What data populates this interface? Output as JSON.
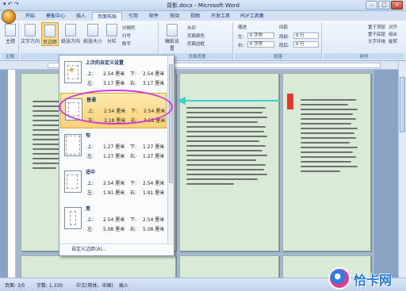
{
  "window": {
    "title": "背影.docx - Microsoft Word",
    "min": "–",
    "max": "□",
    "close": "×"
  },
  "qat": {
    "label": "▾ ↶ ↷"
  },
  "tabs": [
    {
      "label": "开始"
    },
    {
      "label": "模板中心"
    },
    {
      "label": "插入"
    },
    {
      "label": "页面布局"
    },
    {
      "label": "引用"
    },
    {
      "label": "邮件"
    },
    {
      "label": "审阅"
    },
    {
      "label": "视图"
    },
    {
      "label": "开发工具"
    },
    {
      "label": "PDF工具集"
    }
  ],
  "ribbon": {
    "themes": {
      "label": "主题",
      "btn": "主题"
    },
    "page_setup": {
      "text_dir": "文字方向",
      "margins": "页边距",
      "orientation": "纸张方向",
      "size": "纸张大小",
      "columns": "分栏",
      "breaks": "分隔符",
      "line_numbers": "行号",
      "hyphenation": "断字"
    },
    "bg": {
      "label": "页面背景",
      "manuscript": "稿纸设置",
      "watermark": "水印",
      "page_color": "页面颜色",
      "page_border": "页面边框"
    },
    "paragraph": {
      "label": "段落",
      "indent": "缩进",
      "spacing": "间距",
      "left": "左:",
      "right": "右:",
      "before": "段前:",
      "after": "段后:",
      "left_val": "0 字符",
      "right_val": "0 字符",
      "before_val": "0 行",
      "after_val": "0 行"
    },
    "arrange": {
      "label": "排列",
      "bring_front": "置于顶层",
      "send_back": "置于底层",
      "position": "位置",
      "align": "对齐",
      "group": "组合",
      "rotate": "旋转",
      "wrap": "文字环绕"
    },
    "theme_group": "主题"
  },
  "margins_menu": {
    "options": [
      {
        "name": "上次的自定义设置",
        "top_lbl": "上:",
        "top": "2.54 厘米",
        "bottom_lbl": "下:",
        "bottom": "2.54 厘米",
        "left_lbl": "左:",
        "left": "3.17 厘米",
        "right_lbl": "右:",
        "right": "3.17 厘米"
      },
      {
        "name": "普通",
        "top_lbl": "上:",
        "top": "2.54 厘米",
        "bottom_lbl": "下:",
        "bottom": "2.54 厘米",
        "left_lbl": "左:",
        "left": "3.18 厘米",
        "right_lbl": "右:",
        "right": "3.18 厘米"
      },
      {
        "name": "窄",
        "top_lbl": "上:",
        "top": "1.27 厘米",
        "bottom_lbl": "下:",
        "bottom": "1.27 厘米",
        "left_lbl": "左:",
        "left": "1.27 厘米",
        "right_lbl": "右:",
        "right": "1.27 厘米"
      },
      {
        "name": "适中",
        "top_lbl": "上:",
        "top": "2.54 厘米",
        "bottom_lbl": "下:",
        "bottom": "2.54 厘米",
        "left_lbl": "左:",
        "left": "1.91 厘米",
        "right_lbl": "右:",
        "right": "1.91 厘米"
      },
      {
        "name": "宽",
        "top_lbl": "上:",
        "top": "2.54 厘米",
        "bottom_lbl": "下:",
        "bottom": "2.54 厘米",
        "left_lbl": "左:",
        "left": "5.08 厘米",
        "right_lbl": "右:",
        "right": "5.08 厘米"
      }
    ],
    "custom": "自定义边距(A)..."
  },
  "status": {
    "page": "页面: 3/5",
    "words": "字数: 1,330",
    "lang": "中文(简体，中国)",
    "mode": "插入"
  },
  "logo": {
    "text": "恰卡网"
  },
  "colors": {
    "page_bg": "#d9ebd6",
    "highlight": "#d03ad4",
    "arrow": "#3fd0cf",
    "selected": "#f9d17a"
  }
}
